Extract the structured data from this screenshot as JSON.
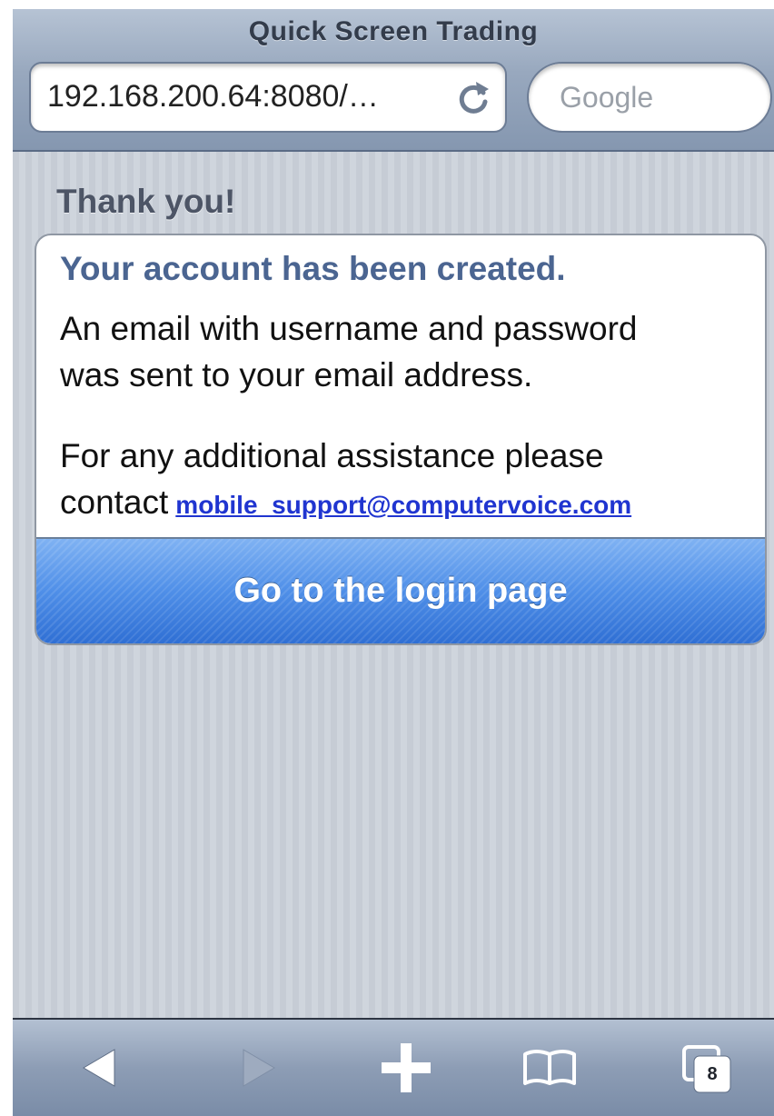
{
  "browser": {
    "title": "Quick Screen Trading",
    "address": "192.168.200.64:8080/…",
    "search_placeholder": "Google",
    "tabs_count": "8"
  },
  "page": {
    "heading": "Thank you!",
    "card_title": "Your account has been created.",
    "lines": [
      "An email with username and password",
      "was sent to your email address.",
      "For any additional assistance please",
      "contact"
    ],
    "support_email": "mobile_support@computervoice.com",
    "login_button": "Go to the login page"
  },
  "icons": [
    "reload-icon",
    "back-icon",
    "forward-icon",
    "add-icon",
    "bookmarks-icon",
    "tabs-icon"
  ],
  "colors": {
    "accent_blue": "#4f8fe8",
    "title_blue": "#4b6591",
    "link_blue": "#2035d0"
  }
}
